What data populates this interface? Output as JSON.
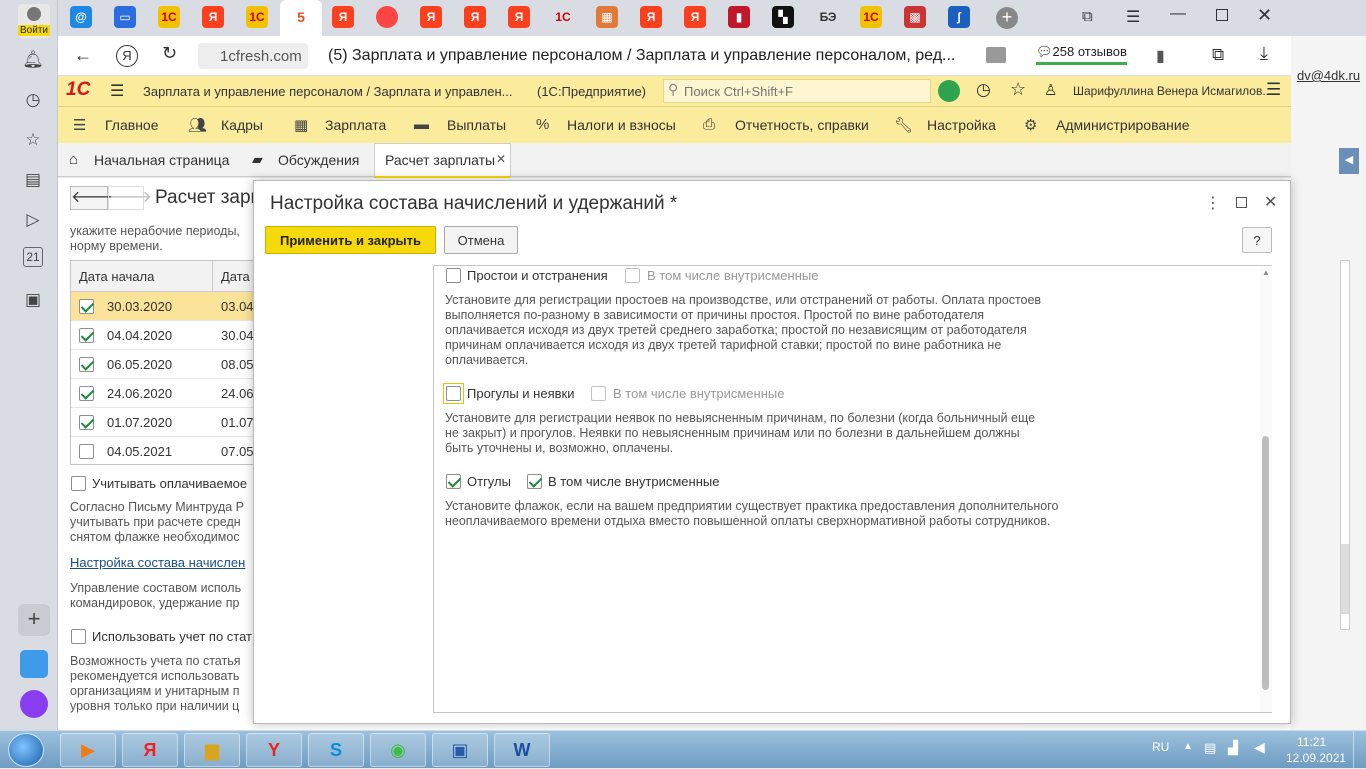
{
  "browser": {
    "login_label": "Войти",
    "active_tab_badge": "5",
    "url_host": "1cfresh.com",
    "page_title": "(5) Зарплата и управление персоналом / Зарплата и управление персоналом, ред...",
    "reviews": "258 отзывов",
    "outside_email": "dv@4dk.ru"
  },
  "app_header": {
    "title": "Зарплата и управление персоналом / Зарплата и управлен...",
    "platform": "(1С:Предприятие)",
    "search_placeholder": "Поиск Ctrl+Shift+F",
    "user": "Шарифуллина Венера Исмагилов..."
  },
  "main_menu": [
    {
      "label": "Главное"
    },
    {
      "label": "Кадры"
    },
    {
      "label": "Зарплата"
    },
    {
      "label": "Выплаты"
    },
    {
      "label": "Налоги и взносы"
    },
    {
      "label": "Отчетность, справки"
    },
    {
      "label": "Настройка"
    },
    {
      "label": "Администрирование"
    }
  ],
  "open_tabs": {
    "home": "Начальная страница",
    "discussions": "Обсуждения",
    "payroll": "Расчет зарплаты"
  },
  "background_form": {
    "title": "Расчет зарп",
    "hint": "укажите нерабочие периоды,",
    "hint2": "норму времени.",
    "col_start": "Дата начала",
    "col_end": "Дата",
    "rows": [
      {
        "start": "30.03.2020",
        "end": "03.04",
        "checked": true
      },
      {
        "start": "04.04.2020",
        "end": "30.04",
        "checked": true
      },
      {
        "start": "06.05.2020",
        "end": "08.05",
        "checked": true
      },
      {
        "start": "24.06.2020",
        "end": "24.06",
        "checked": true
      },
      {
        "start": "01.07.2020",
        "end": "01.07",
        "checked": true
      },
      {
        "start": "04.05.2021",
        "end": "07.05",
        "checked": false
      }
    ],
    "paid_label": "Учитывать оплачиваемое",
    "letter_text1": "Согласно Письму Минтруда Р",
    "letter_text2": "учитывать при расчете средн",
    "letter_text3": "снятом флажке необходимос",
    "link": "Настройка состава начислен",
    "mgmt_text1": "Управление составом исполь",
    "mgmt_text2": "командировок, удержание пр",
    "articles_label": "Использовать учет по стат",
    "possibility1": "Возможность учета по статья",
    "possibility2": "рекомендуется использовать",
    "possibility3": "организациям и унитарным п",
    "possibility4": "уровня только при наличии ц"
  },
  "modal": {
    "title": "Настройка состава начислений и удержаний *",
    "apply_button": "Применить и закрыть",
    "cancel_button": "Отмена",
    "help_button": "?",
    "sections": [
      {
        "label": "Простои и отстранения",
        "checked": false,
        "sub_label": "В том числе внутрисменные",
        "sub_checked": false,
        "desc_lines": [
          "Установите для регистрации простоев на производстве, или отстранений от работы. Оплата простоев",
          "выполняется по-разному в зависимости от причины простоя. Простой по вине работодателя",
          "оплачивается исходя из двух третей среднего заработка; простой по независящим от работодателя",
          "причинам оплачивается исходя из двух третей тарифной ставки; простой по вине работника не",
          "оплачивается."
        ]
      },
      {
        "label": "Прогулы и неявки",
        "checked": false,
        "sub_label": "В том числе внутрисменные",
        "sub_checked": false,
        "desc_lines": [
          "Установите для регистрации неявок по невыясненным причинам, по болезни (когда больничный еще",
          "не закрыт) и прогулов. Неявки по невыясненным причинам или по болезни в дальнейшем должны",
          "быть уточнены и, возможно, оплачены."
        ]
      },
      {
        "label": "Отгулы",
        "checked": true,
        "sub_label": "В том числе внутрисменные",
        "sub_checked": true,
        "desc_lines": [
          "Установите флажок, если на вашем предприятии существует практика предоставления дополнительного",
          "неоплачиваемого времени отдыха вместо повышенной оплаты сверхнормативной работы сотрудников."
        ]
      }
    ]
  },
  "taskbar": {
    "lang": "RU",
    "time": "11:21",
    "date": "12.09.2021"
  },
  "colors": {
    "accent_yellow": "#fbeb9c",
    "apply_button": "#f5d90a",
    "check_green": "#1a8a3a",
    "selected_row": "#fbe39a"
  }
}
